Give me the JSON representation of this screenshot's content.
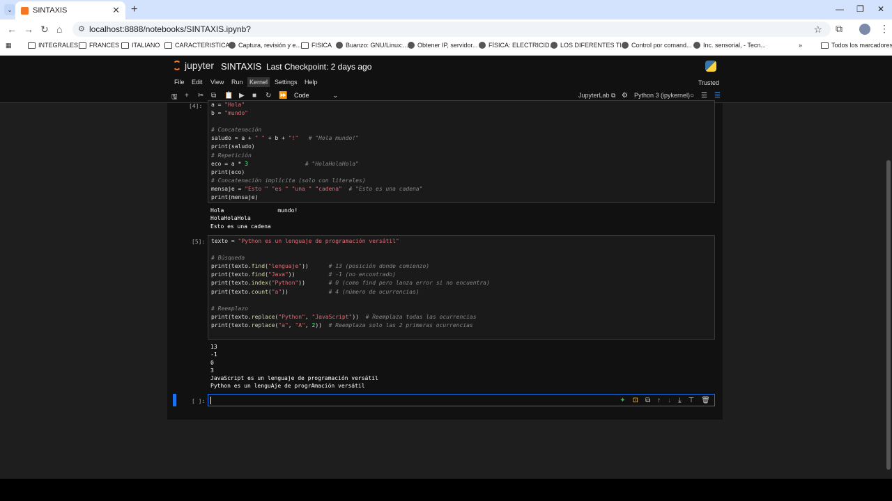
{
  "browser": {
    "tab_title": "SINTAXIS",
    "tab_close": "✕",
    "new_tab": "+",
    "url": "localhost:8888/notebooks/SINTAXIS.ipynb?",
    "bookmarks": [
      "INTEGRALES",
      "FRANCES",
      "ITALIANO",
      "CARACTERISTICAS",
      "Captura, revisión y e...",
      "FISICA",
      "Buanzo: GNU/Linux:...",
      "Obtener IP, servidor...",
      "FÍSICA: ELECTRICID...",
      "LOS DIFERENTES TI...",
      "Control por comand...",
      "Inc. sensorial, - Tecn..."
    ],
    "all_bookmarks": "Todos los marcadores"
  },
  "jupyter": {
    "logo": "jupyter",
    "notebook_name": "SINTAXIS",
    "checkpoint": "Last Checkpoint: 2 days ago",
    "menus": [
      "File",
      "Edit",
      "View",
      "Run",
      "Kernel",
      "Settings",
      "Help"
    ],
    "trusted": "Trusted",
    "cell_type": "Code",
    "jupyterlab": "JupyterLab",
    "kernel": "Python 3 (ipykernel)"
  },
  "cells": {
    "c4_prompt": "[4]:",
    "c4_out": "Hola                mundo!\nHolaHolaHola\nEsto es una cadena",
    "c5_prompt": "[5]:",
    "c5_out": "13\n-1\n0\n3\nJavaScript es un lenguaje de programación versátil\nPython es un lenguAje de progrAmación versátil",
    "c6_prompt": "[ ]:"
  }
}
